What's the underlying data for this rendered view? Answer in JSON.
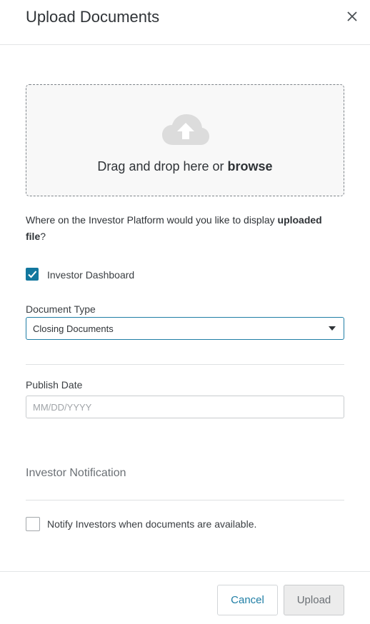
{
  "header": {
    "title": "Upload Documents",
    "close_icon": "close-icon"
  },
  "dropzone": {
    "icon": "cloud-upload-icon",
    "text": "Drag and drop here or ",
    "browse_label": "browse"
  },
  "display_question": {
    "text_before": "Where on the Investor Platform would you like to display ",
    "emphasis": "uploaded file",
    "text_after": "?"
  },
  "investor_dashboard": {
    "label": "Investor Dashboard",
    "checked": true
  },
  "document_type": {
    "label": "Document Type",
    "selected": "Closing Documents"
  },
  "publish_date": {
    "label": "Publish Date",
    "value": "",
    "placeholder": "MM/DD/YYYY"
  },
  "investor_notification": {
    "title": "Investor Notification",
    "notify_label": "Notify Investors when documents are available.",
    "checked": false
  },
  "footer": {
    "cancel_label": "Cancel",
    "upload_label": "Upload"
  },
  "colors": {
    "accent": "#12779e",
    "link": "#1f7ea5",
    "border": "#dfe1e3"
  }
}
